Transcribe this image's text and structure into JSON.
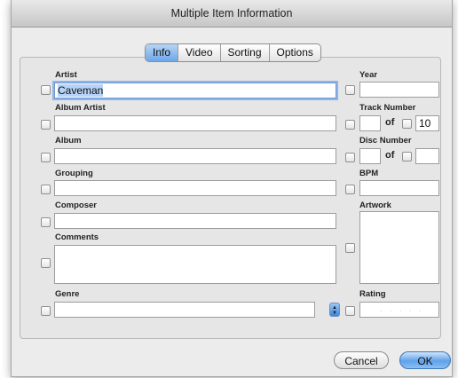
{
  "window": {
    "title": "Multiple Item Information"
  },
  "tabs": [
    "Info",
    "Video",
    "Sorting",
    "Options"
  ],
  "active_tab": "Info",
  "fields": {
    "artist": {
      "label": "Artist",
      "value": "Caveman"
    },
    "album_artist": {
      "label": "Album Artist",
      "value": ""
    },
    "album": {
      "label": "Album",
      "value": ""
    },
    "grouping": {
      "label": "Grouping",
      "value": ""
    },
    "composer": {
      "label": "Composer",
      "value": ""
    },
    "comments": {
      "label": "Comments",
      "value": ""
    },
    "genre": {
      "label": "Genre",
      "value": ""
    },
    "year": {
      "label": "Year",
      "value": ""
    },
    "track_number": {
      "label": "Track Number",
      "value": "",
      "of_label": "of",
      "of_value": "10"
    },
    "disc_number": {
      "label": "Disc Number",
      "value": "",
      "of_label": "of",
      "of_value": ""
    },
    "bpm": {
      "label": "BPM",
      "value": ""
    },
    "artwork": {
      "label": "Artwork"
    },
    "rating": {
      "label": "Rating",
      "value": "· · · · ·"
    }
  },
  "buttons": {
    "cancel": "Cancel",
    "ok": "OK"
  },
  "colors": {
    "selection": "#b5d3f7",
    "accent": "#5ea1ea"
  }
}
